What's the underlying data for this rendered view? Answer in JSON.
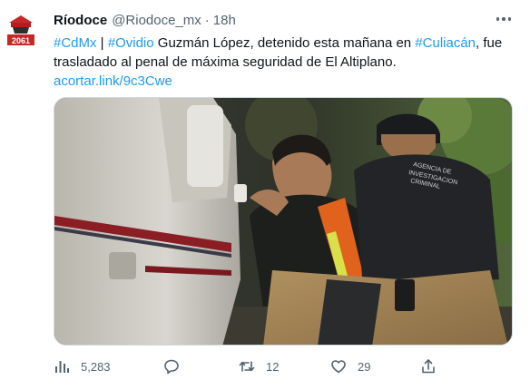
{
  "tweet": {
    "author_name": "Ríodoce",
    "handle": "@Riodoce_mx",
    "separator": "·",
    "time": "18h",
    "avatar_text": "2061",
    "text_parts": [
      {
        "text": "#CdMx",
        "link": true
      },
      {
        "text": " | ",
        "link": false
      },
      {
        "text": "#Ovidio",
        "link": true
      },
      {
        "text": " Guzmán López, detenido esta mañana en ",
        "link": false
      },
      {
        "text": "#Culiacán",
        "link": true
      },
      {
        "text": ", fue",
        "link": false
      },
      {
        "text": "trasladado al penal de máxima seguridad de El Altiplano.",
        "link": false
      },
      {
        "text": "acortar.link/9c3Cwe",
        "link": true
      }
    ],
    "media": {
      "vest_text": [
        "AGENCIA DE",
        "INVESTIGACION",
        "CRIMINAL"
      ]
    }
  },
  "actions": {
    "views": "5,283",
    "replies": "",
    "retweets": "12",
    "likes": "29"
  },
  "colors": {
    "link": "#1d9bf0",
    "secondary_text": "#536471",
    "primary_text": "#0f1419"
  }
}
